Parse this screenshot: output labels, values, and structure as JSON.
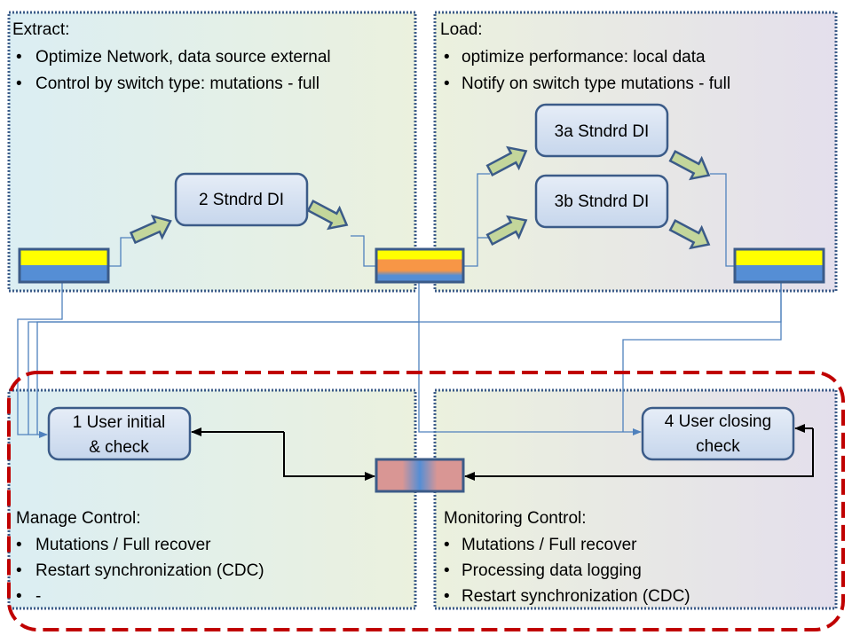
{
  "extract": {
    "title": "Extract:",
    "bullets": [
      "Optimize Network, data source external",
      "Control by switch type: mutations - full"
    ]
  },
  "load": {
    "title": "Load:",
    "bullets": [
      "optimize performance: local data",
      "Notify on switch type mutations - full"
    ]
  },
  "manage": {
    "title": "Manage Control:",
    "bullets": [
      "Mutations / Full recover",
      "Restart synchronization (CDC)",
      "-"
    ]
  },
  "monitoring": {
    "title": "Monitoring Control:",
    "bullets": [
      "Mutations / Full recover",
      "Processing data logging",
      "Restart synchronization (CDC)"
    ]
  },
  "nodes": {
    "n2": "2 Stndrd DI",
    "n3a": "3a Stndrd DI",
    "n3b": "3b Stndrd DI",
    "n1": [
      "1 User initial",
      "& check"
    ],
    "n4": [
      "4 User closing",
      "check"
    ]
  },
  "bullet_char": "•",
  "colors": {
    "border": "#3b5b88",
    "line": "#4f81bd",
    "arrow_fill": "#c3d69b",
    "dashed_frame": "#c00000",
    "yellow": "#ffff00",
    "blue": "#558ed5",
    "orange": "#f79646",
    "pink": "#d99694"
  }
}
